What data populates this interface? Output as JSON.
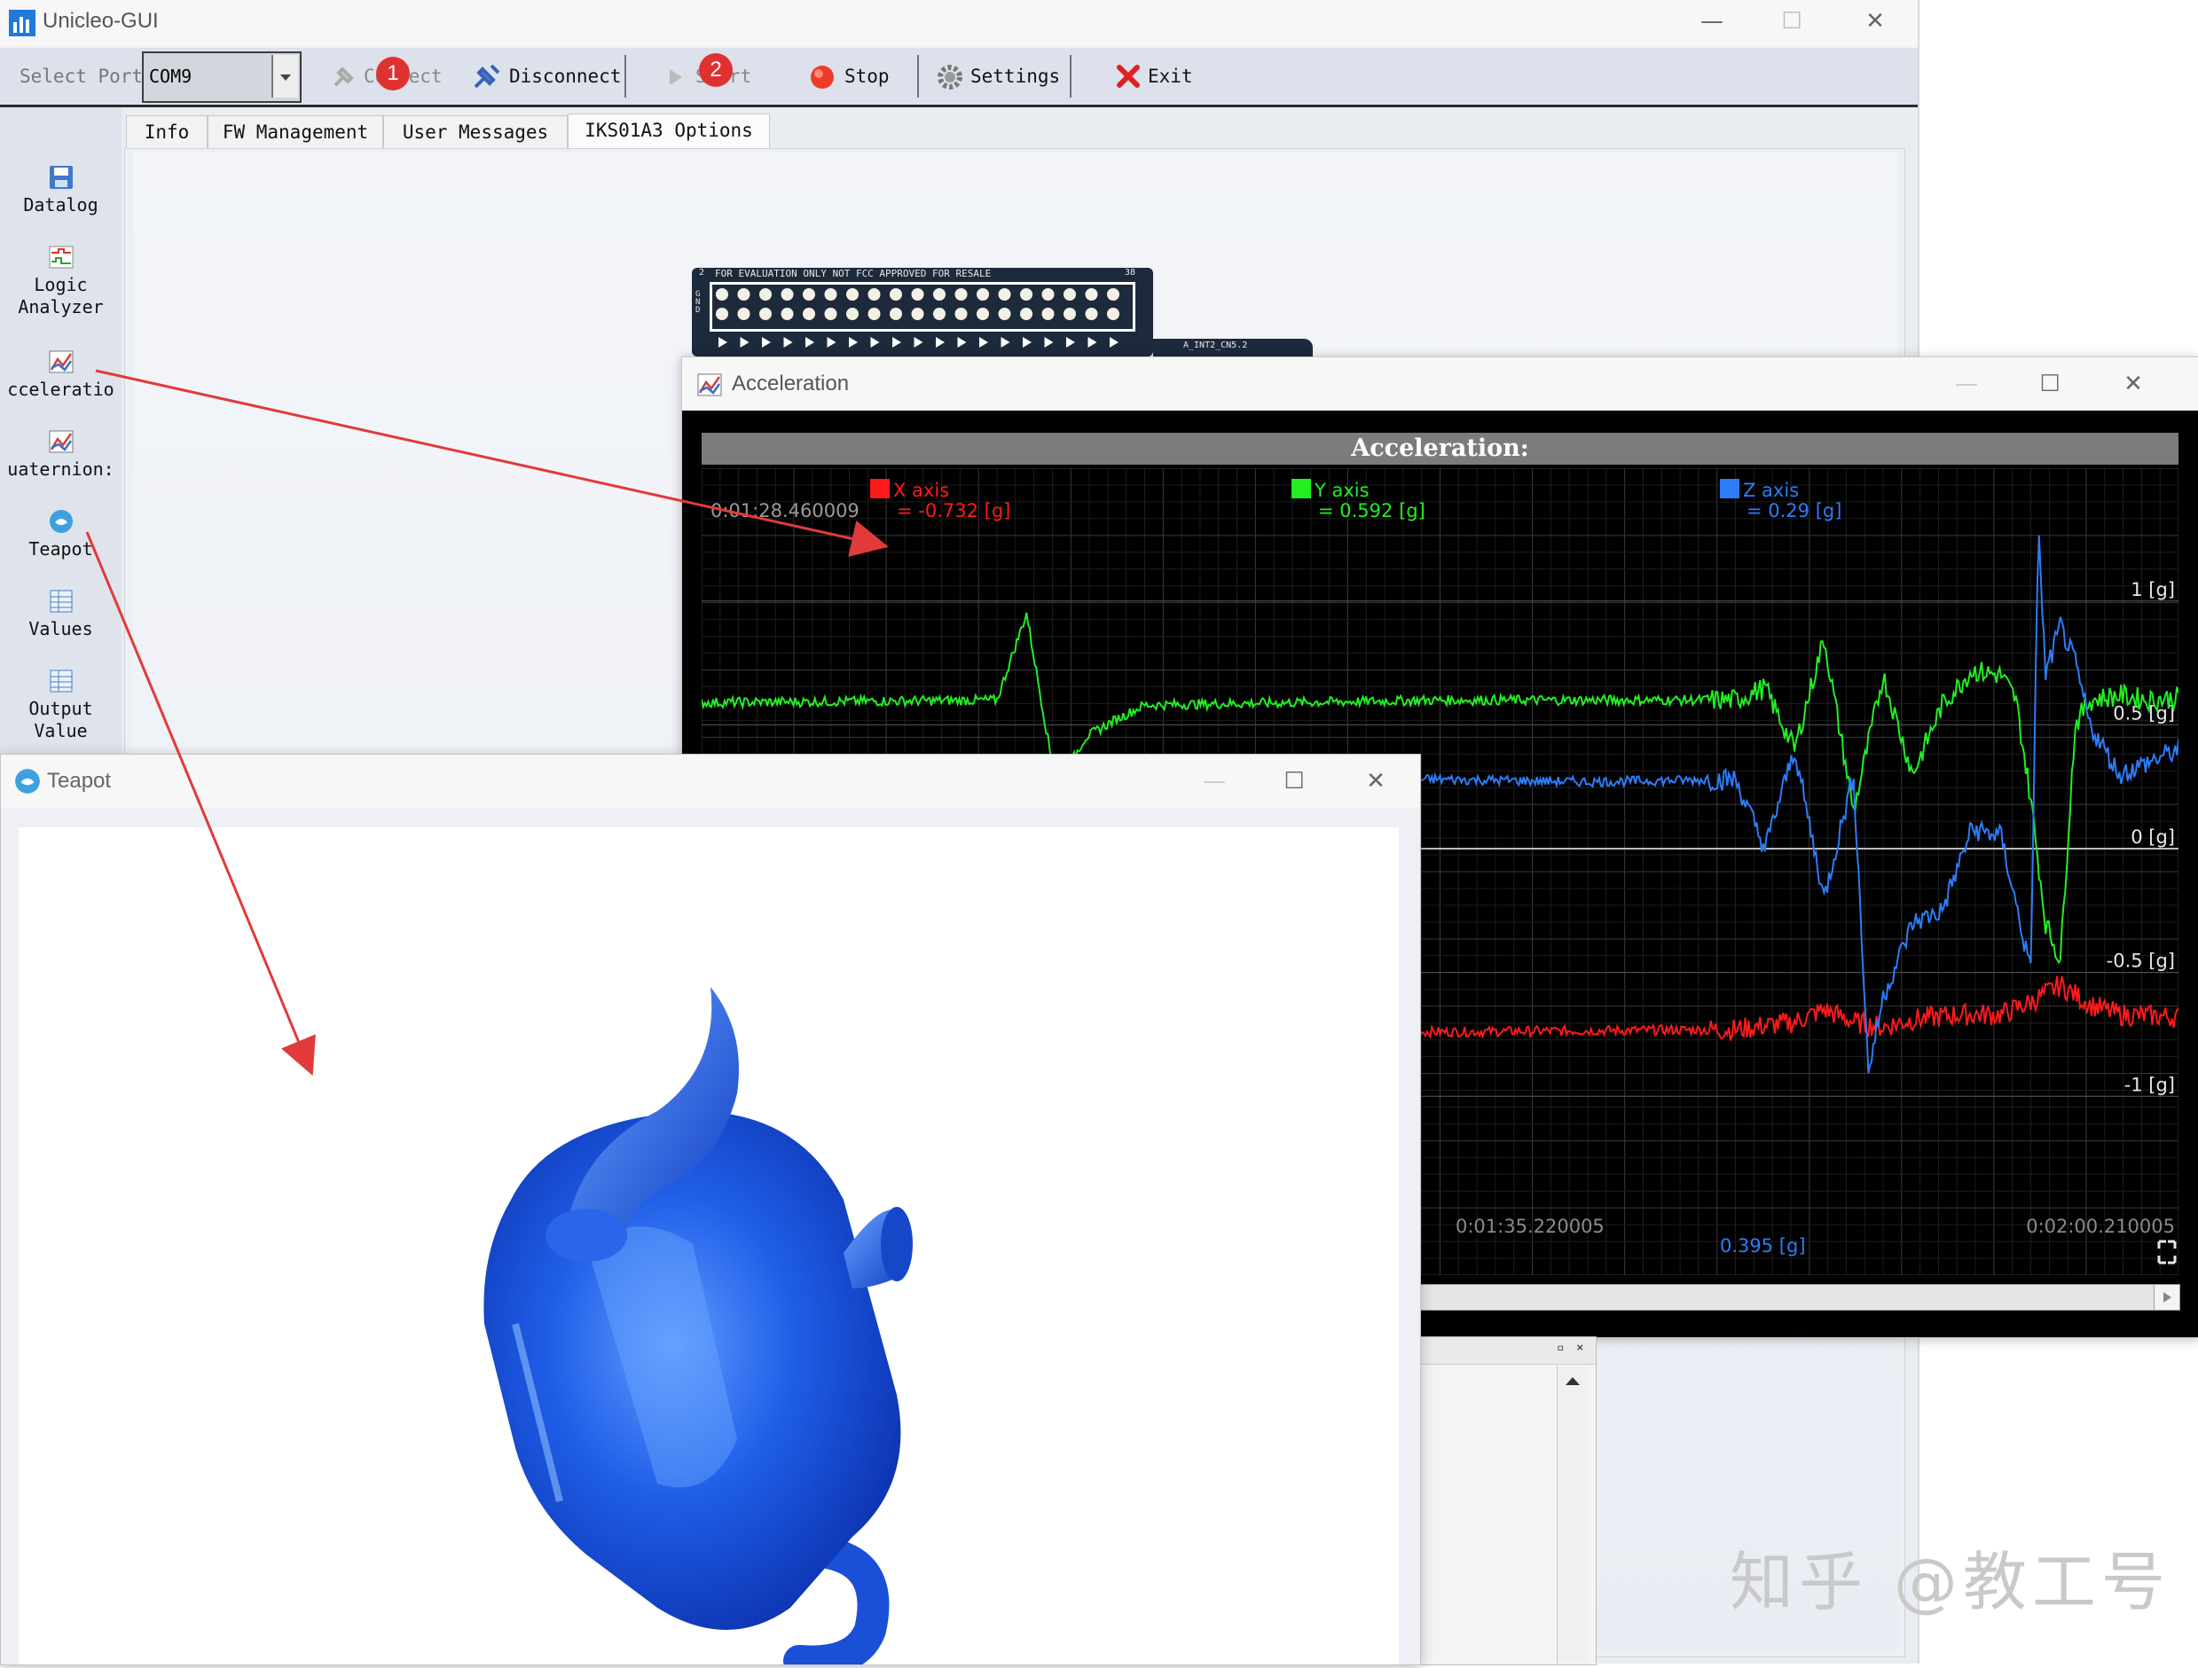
{
  "app": {
    "title": "Unicleo-GUI",
    "minimize": "—",
    "maximize": "☐",
    "close": "✕"
  },
  "toolbar": {
    "port_label": "Select Port",
    "port_value": "COM9",
    "connect": "Connect",
    "disconnect": "Disconnect",
    "start": "Start",
    "stop": "Stop",
    "settings": "Settings",
    "exit": "Exit",
    "badge_1": "1",
    "badge_2": "2"
  },
  "sidebar": {
    "items": [
      {
        "label": "Datalog",
        "icon": "floppy-icon"
      },
      {
        "label": "Logic Analyzer",
        "icon": "logic-analyzer-icon"
      },
      {
        "label": "cceleratio",
        "icon": "chart-icon"
      },
      {
        "label": "uaternion:",
        "icon": "chart-icon"
      },
      {
        "label": "Teapot",
        "icon": "teapot-icon"
      },
      {
        "label": "Values",
        "icon": "table-icon"
      },
      {
        "label": "Output Value",
        "icon": "table-icon"
      }
    ]
  },
  "tabs": [
    {
      "label": "Info"
    },
    {
      "label": "FW Management"
    },
    {
      "label": "User Messages"
    },
    {
      "label": "IKS01A3 Options"
    }
  ],
  "board": {
    "silk_top": "FOR EVALUATION ONLY    NOT FCC APPROVED FOR RESALE",
    "pin_left": "2",
    "pin_right": "38",
    "gnd": "GND",
    "silk_side": "A_INT2_CN5.2"
  },
  "accel_window": {
    "title": "Acceleration",
    "header": "Acceleration:",
    "cursor_time": "0:01:28.460009",
    "legend": [
      {
        "name": "X axis",
        "value": "= -0.732 [g]",
        "color": "#ff1a1a"
      },
      {
        "name": "Y axis",
        "value": "= 0.592 [g]",
        "color": "#22ee22"
      },
      {
        "name": "Z axis",
        "value": "= 0.29 [g]",
        "color": "#2c7df7"
      }
    ],
    "time_mid": "0:01:35.220005",
    "time_end": "0:02:00.210005",
    "scale_readout": "0.395 [g]"
  },
  "chart_data": {
    "type": "line",
    "title": "Acceleration:",
    "xlabel": "",
    "ylabel": "",
    "x_range": [
      "0:01:28.460009",
      "0:02:00.210005"
    ],
    "ylim": [
      -1.4,
      1.25
    ],
    "yticks": [
      "1 [g]",
      "0.5 [g]",
      "0 [g]",
      "-0.5 [g]",
      "-1 [g]"
    ],
    "grid": true,
    "legend_position": "top",
    "series": [
      {
        "name": "X axis",
        "color": "#ff1a1a",
        "x": [
          0.0,
          0.25,
          0.5,
          0.7,
          0.74,
          0.76,
          0.78,
          0.8,
          0.82,
          0.85,
          0.88,
          0.9,
          0.92,
          0.94,
          0.96,
          1.0
        ],
        "values": [
          -0.73,
          -0.73,
          -0.74,
          -0.73,
          -0.7,
          -0.65,
          -0.7,
          -0.72,
          -0.69,
          -0.67,
          -0.67,
          -0.62,
          -0.55,
          -0.63,
          -0.67,
          -0.68
        ]
      },
      {
        "name": "Y axis",
        "color": "#22ee22",
        "x": [
          0.0,
          0.2,
          0.22,
          0.24,
          0.26,
          0.28,
          0.3,
          0.5,
          0.7,
          0.72,
          0.74,
          0.76,
          0.78,
          0.8,
          0.82,
          0.84,
          0.86,
          0.88,
          0.89,
          0.9,
          0.91,
          0.92,
          0.93,
          0.94,
          0.96,
          0.98,
          1.0
        ],
        "values": [
          0.59,
          0.6,
          0.95,
          0.25,
          0.45,
          0.52,
          0.58,
          0.6,
          0.6,
          0.65,
          0.4,
          0.85,
          0.15,
          0.7,
          0.3,
          0.58,
          0.72,
          0.7,
          0.6,
          0.2,
          -0.3,
          -0.45,
          0.5,
          0.6,
          0.62,
          0.6,
          0.61
        ]
      },
      {
        "name": "Z axis",
        "color": "#2c7df7",
        "x": [
          0.0,
          0.3,
          0.5,
          0.6,
          0.7,
          0.72,
          0.74,
          0.76,
          0.78,
          0.79,
          0.8,
          0.82,
          0.84,
          0.86,
          0.88,
          0.9,
          0.905,
          0.91,
          0.92,
          0.93,
          0.94,
          0.96,
          1.0
        ],
        "values": [
          0.28,
          0.27,
          0.28,
          0.27,
          0.28,
          0.0,
          0.4,
          -0.2,
          0.3,
          -0.9,
          -0.6,
          -0.3,
          -0.25,
          0.08,
          0.05,
          -0.5,
          1.3,
          0.7,
          0.9,
          0.75,
          0.5,
          0.3,
          0.4
        ]
      }
    ]
  },
  "teapot_window": {
    "title": "Teapot"
  },
  "watermark": "知乎 @教工号"
}
